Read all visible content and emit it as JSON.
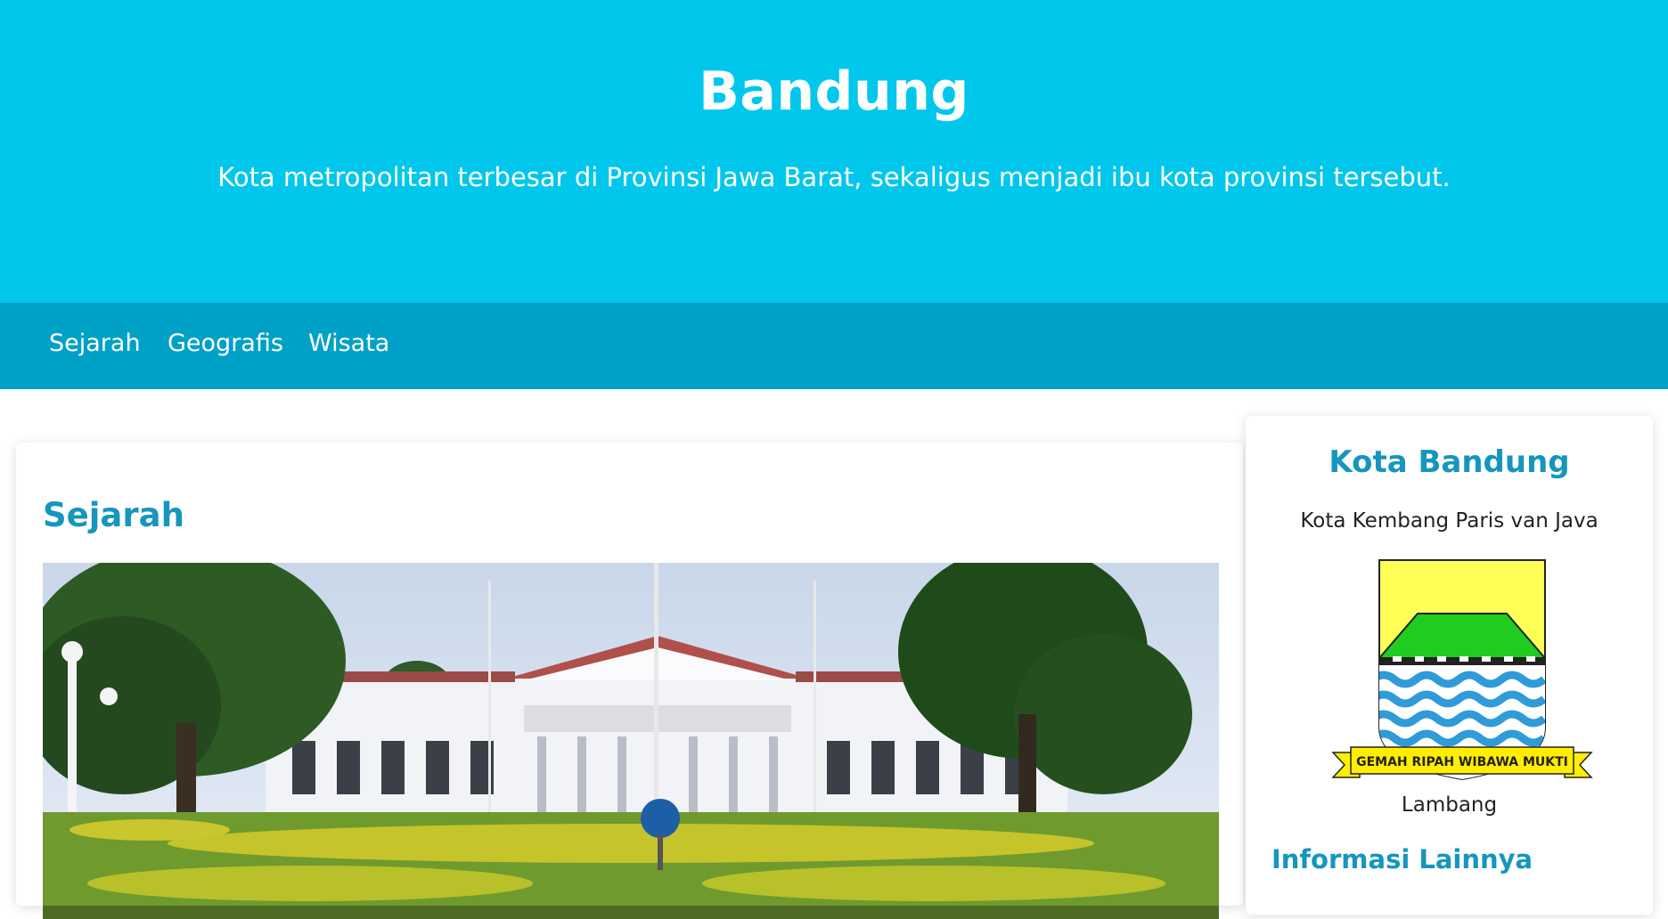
{
  "header": {
    "title": "Bandung",
    "subtitle": "Kota metropolitan terbesar di Provinsi Jawa Barat, sekaligus menjadi ibu kota provinsi tersebut."
  },
  "nav": {
    "items": [
      {
        "label": "Sejarah"
      },
      {
        "label": "Geografis"
      },
      {
        "label": "Wisata"
      }
    ]
  },
  "main": {
    "section_title": "Sejarah"
  },
  "sidebar": {
    "title": "Kota Bandung",
    "tagline": "Kota Kembang Paris van Java",
    "emblem_motto": "GEMAH RIPAH WIBAWA MUKTI",
    "emblem_caption": "Lambang",
    "more_info_title": "Informasi Lainnya"
  },
  "colors": {
    "hero_bg": "#00c7eb",
    "nav_bg": "#00a1c6",
    "accent": "#1696bd"
  }
}
